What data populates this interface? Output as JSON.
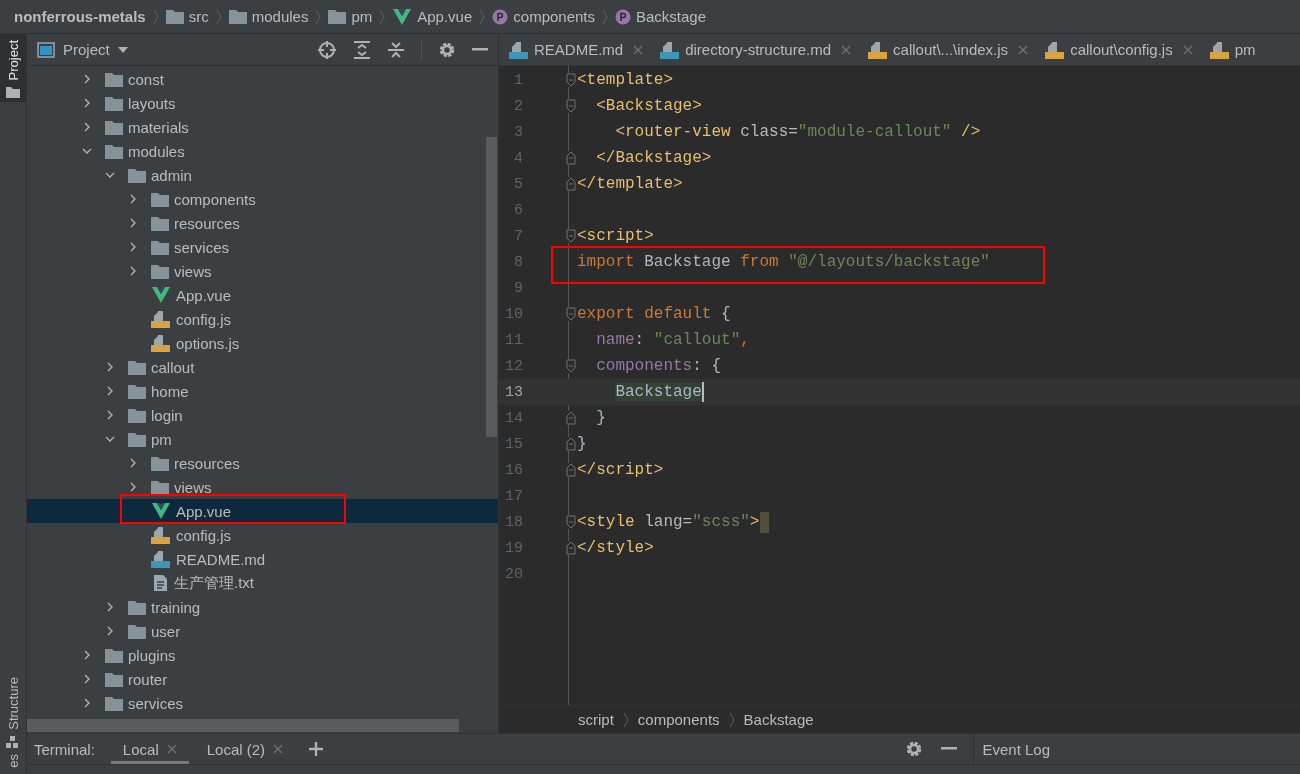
{
  "navbar": {
    "crumbs": [
      {
        "text": "nonferrous-metals",
        "kind": "project"
      },
      {
        "text": "src",
        "kind": "folder"
      },
      {
        "text": "modules",
        "kind": "folder"
      },
      {
        "text": "pm",
        "kind": "folder"
      },
      {
        "text": "App.vue",
        "kind": "vue"
      },
      {
        "text": "components",
        "kind": "property"
      },
      {
        "text": "Backstage",
        "kind": "property"
      }
    ]
  },
  "side_stripe": {
    "top": [
      {
        "label": "Project",
        "selected": true
      }
    ],
    "bottom": [
      {
        "label": "Structure",
        "selected": false
      },
      {
        "label": "es",
        "selected": false
      }
    ]
  },
  "project_panel": {
    "title": "Project",
    "tree": [
      {
        "name": "const",
        "kind": "folder",
        "expanded": false,
        "selected": false,
        "highlighted": false
      },
      {
        "name": "layouts",
        "kind": "folder",
        "expanded": false,
        "selected": false,
        "highlighted": false
      },
      {
        "name": "materials",
        "kind": "folder",
        "expanded": false,
        "selected": false,
        "highlighted": false
      },
      {
        "name": "modules",
        "kind": "folder",
        "expanded": true,
        "selected": false,
        "highlighted": false,
        "children": [
          {
            "name": "admin",
            "kind": "folder",
            "expanded": true,
            "selected": false,
            "highlighted": false,
            "children": [
              {
                "name": "components",
                "kind": "folder",
                "expanded": false,
                "selected": false,
                "highlighted": false
              },
              {
                "name": "resources",
                "kind": "folder",
                "expanded": false,
                "selected": false,
                "highlighted": false
              },
              {
                "name": "services",
                "kind": "folder",
                "expanded": false,
                "selected": false,
                "highlighted": false
              },
              {
                "name": "views",
                "kind": "folder",
                "expanded": false,
                "selected": false,
                "highlighted": false
              },
              {
                "name": "App.vue",
                "kind": "vue",
                "selected": false,
                "highlighted": false
              },
              {
                "name": "config.js",
                "kind": "js",
                "selected": false,
                "highlighted": false
              },
              {
                "name": "options.js",
                "kind": "js",
                "selected": false,
                "highlighted": false
              }
            ]
          },
          {
            "name": "callout",
            "kind": "folder",
            "expanded": false,
            "selected": false,
            "highlighted": false
          },
          {
            "name": "home",
            "kind": "folder",
            "expanded": false,
            "selected": false,
            "highlighted": false
          },
          {
            "name": "login",
            "kind": "folder",
            "expanded": false,
            "selected": false,
            "highlighted": false
          },
          {
            "name": "pm",
            "kind": "folder",
            "expanded": true,
            "selected": false,
            "highlighted": false,
            "children": [
              {
                "name": "resources",
                "kind": "folder",
                "expanded": false,
                "selected": false,
                "highlighted": false
              },
              {
                "name": "views",
                "kind": "folder",
                "expanded": false,
                "selected": false,
                "highlighted": false
              },
              {
                "name": "App.vue",
                "kind": "vue",
                "selected": true,
                "highlighted": true
              },
              {
                "name": "config.js",
                "kind": "js",
                "selected": false,
                "highlighted": false
              },
              {
                "name": "README.md",
                "kind": "md",
                "selected": false,
                "highlighted": false
              },
              {
                "name": "生产管理.txt",
                "kind": "txt",
                "selected": false,
                "highlighted": false
              }
            ]
          },
          {
            "name": "training",
            "kind": "folder",
            "expanded": false,
            "selected": false,
            "highlighted": false
          },
          {
            "name": "user",
            "kind": "folder",
            "expanded": false,
            "selected": false,
            "highlighted": false
          }
        ]
      },
      {
        "name": "plugins",
        "kind": "folder",
        "expanded": false,
        "selected": false,
        "highlighted": false
      },
      {
        "name": "router",
        "kind": "folder",
        "expanded": false,
        "selected": false,
        "highlighted": false
      },
      {
        "name": "services",
        "kind": "folder",
        "expanded": false,
        "selected": false,
        "highlighted": false
      }
    ]
  },
  "editor": {
    "tabs": [
      {
        "label": "README.md",
        "kind": "md",
        "selected": false,
        "closable": true
      },
      {
        "label": "directory-structure.md",
        "kind": "md",
        "selected": false,
        "closable": true
      },
      {
        "label": "callout\\...\\index.js",
        "kind": "js",
        "selected": false,
        "closable": true
      },
      {
        "label": "callout\\config.js",
        "kind": "js",
        "selected": false,
        "closable": true
      },
      {
        "label": "pm",
        "kind": "js",
        "selected": false,
        "closable": false
      }
    ],
    "lines": [
      {
        "number": "1",
        "kind": "opener",
        "current": false,
        "highlighted": false,
        "cursor": false,
        "match_box": false,
        "tokens": [
          {
            "text": "<template>",
            "kind": "tag"
          }
        ]
      },
      {
        "number": "2",
        "kind": "opener",
        "current": false,
        "highlighted": false,
        "cursor": false,
        "match_box": false,
        "tokens": [
          {
            "text": "  <Backstage>",
            "kind": "tag"
          }
        ]
      },
      {
        "number": "3",
        "kind": "plain",
        "current": false,
        "highlighted": false,
        "cursor": false,
        "match_box": false,
        "tokens": [
          {
            "text": "    <router-view",
            "kind": "tag"
          },
          {
            "text": " class=",
            "kind": "attr"
          },
          {
            "text": "\"module-callout\"",
            "kind": "string"
          },
          {
            "text": " />",
            "kind": "tag"
          }
        ]
      },
      {
        "number": "4",
        "kind": "closer",
        "current": false,
        "highlighted": false,
        "cursor": false,
        "match_box": false,
        "tokens": [
          {
            "text": "  </Backstage>",
            "kind": "tag"
          }
        ]
      },
      {
        "number": "5",
        "kind": "closer",
        "current": false,
        "highlighted": false,
        "cursor": false,
        "match_box": false,
        "tokens": [
          {
            "text": "</template>",
            "kind": "tag"
          }
        ]
      },
      {
        "number": "6",
        "kind": "plain",
        "current": false,
        "highlighted": false,
        "cursor": false,
        "match_box": false
      },
      {
        "number": "7",
        "kind": "opener",
        "current": false,
        "highlighted": false,
        "cursor": false,
        "match_box": false,
        "tokens": [
          {
            "text": "<script>",
            "kind": "tag"
          }
        ]
      },
      {
        "number": "8",
        "kind": "plain",
        "current": false,
        "highlighted": true,
        "cursor": false,
        "match_box": false,
        "tokens": [
          {
            "text": "import",
            "kind": "keyword"
          },
          {
            "text": " Backstage ",
            "kind": "plain"
          },
          {
            "text": "from",
            "kind": "keyword"
          },
          {
            "text": " \"@/layouts/backstage\"",
            "kind": "string"
          }
        ]
      },
      {
        "number": "9",
        "kind": "plain",
        "current": false,
        "highlighted": false,
        "cursor": false,
        "match_box": false
      },
      {
        "number": "10",
        "kind": "opener",
        "current": false,
        "highlighted": false,
        "cursor": false,
        "match_box": false,
        "tokens": [
          {
            "text": "export default",
            "kind": "keyword"
          },
          {
            "text": " {",
            "kind": "plain"
          }
        ]
      },
      {
        "number": "11",
        "kind": "plain",
        "current": false,
        "highlighted": false,
        "cursor": false,
        "match_box": false,
        "tokens": [
          {
            "text": "  name",
            "kind": "prop"
          },
          {
            "text": ": ",
            "kind": "plain"
          },
          {
            "text": "\"callout\"",
            "kind": "string"
          },
          {
            "text": ",",
            "kind": "keyword"
          }
        ]
      },
      {
        "number": "12",
        "kind": "opener",
        "current": false,
        "highlighted": false,
        "cursor": false,
        "match_box": false,
        "tokens": [
          {
            "text": "  components",
            "kind": "prop"
          },
          {
            "text": ": {",
            "kind": "plain"
          }
        ]
      },
      {
        "number": "13",
        "kind": "plain",
        "current": true,
        "highlighted": false,
        "cursor": true,
        "match_box": false,
        "tokens": [
          {
            "text": "    Backstage",
            "kind": "usage"
          }
        ]
      },
      {
        "number": "14",
        "kind": "closer",
        "current": false,
        "highlighted": false,
        "cursor": false,
        "match_box": false,
        "tokens": [
          {
            "text": "  }",
            "kind": "plain"
          }
        ]
      },
      {
        "number": "15",
        "kind": "closer",
        "current": false,
        "highlighted": false,
        "cursor": false,
        "match_box": false,
        "tokens": [
          {
            "text": "}",
            "kind": "plain"
          }
        ]
      },
      {
        "number": "16",
        "kind": "closer",
        "current": false,
        "highlighted": false,
        "cursor": false,
        "match_box": false,
        "tokens": [
          {
            "text": "</script>",
            "kind": "tag"
          }
        ]
      },
      {
        "number": "17",
        "kind": "plain",
        "current": false,
        "highlighted": false,
        "cursor": false,
        "match_box": false
      },
      {
        "number": "18",
        "kind": "opener",
        "current": false,
        "highlighted": false,
        "cursor": false,
        "match_box": true,
        "tokens": [
          {
            "text": "<style",
            "kind": "tag"
          },
          {
            "text": " lang=",
            "kind": "attr"
          },
          {
            "text": "\"scss\"",
            "kind": "string"
          },
          {
            "text": ">",
            "kind": "tag"
          }
        ]
      },
      {
        "number": "19",
        "kind": "closer",
        "current": false,
        "highlighted": false,
        "cursor": false,
        "match_box": false,
        "tokens": [
          {
            "text": "</style>",
            "kind": "tag"
          }
        ]
      },
      {
        "number": "20",
        "kind": "plain",
        "current": false,
        "highlighted": false,
        "cursor": false,
        "match_box": false
      }
    ],
    "breadcrumb": [
      "script",
      "components",
      "Backstage"
    ]
  },
  "tool_bar": {
    "label": "Terminal:",
    "tabs": [
      {
        "label": "Local",
        "selected": true
      },
      {
        "label": "Local (2)",
        "selected": false
      }
    ],
    "event_log": "Event Log"
  }
}
